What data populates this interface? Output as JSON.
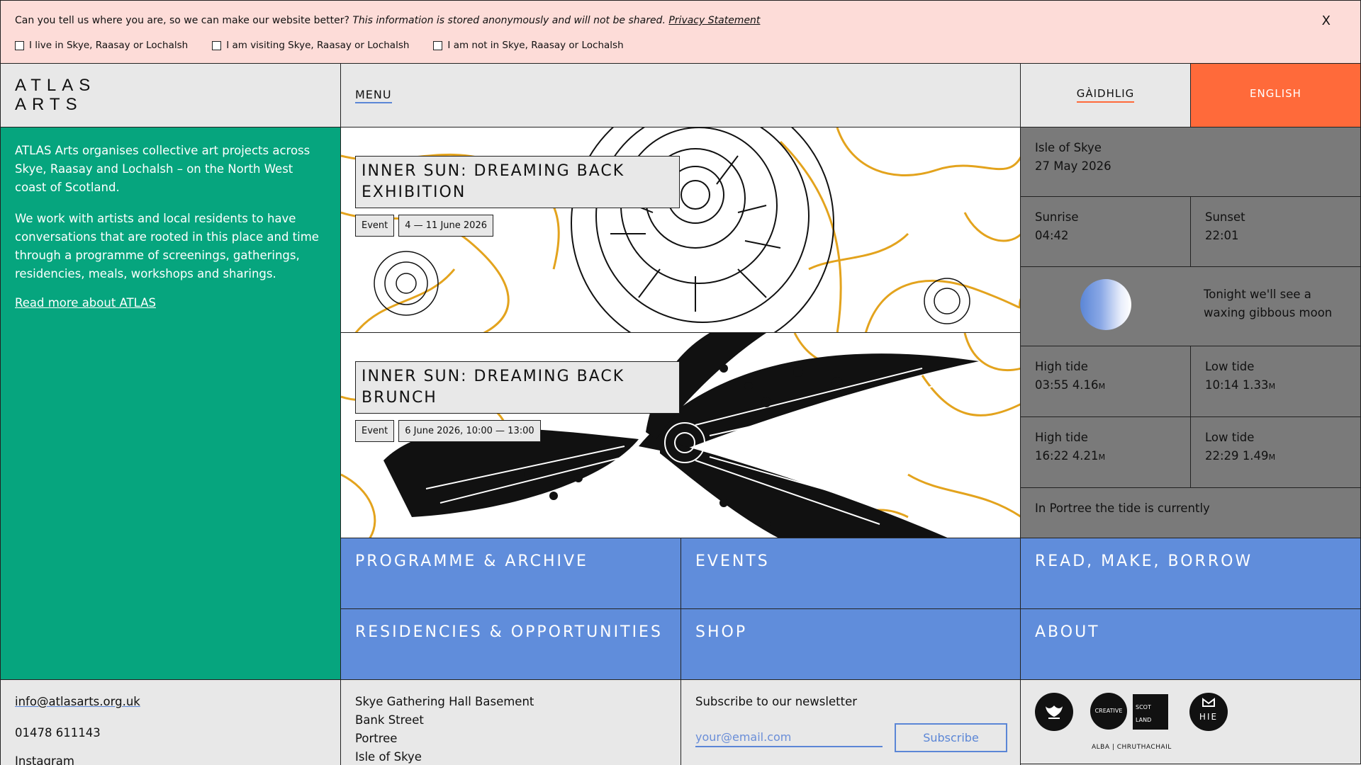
{
  "banner": {
    "question": "Can you tell us where you are, so we can make our website better?",
    "note": "This information is stored anonymously and will not be shared.",
    "privacy_link": "Privacy Statement",
    "close_label": "X",
    "options": [
      "I live in Skye, Raasay or Lochalsh",
      "I am visiting Skye, Raasay or Lochalsh",
      "I am not in Skye, Raasay or Lochalsh"
    ]
  },
  "header": {
    "logo_line1": "ATLAS",
    "logo_line2": "ARTS",
    "menu_label": "MENU",
    "lang_gaelic": "GÀIDHLIG",
    "lang_english": "ENGLISH"
  },
  "about": {
    "para1": "ATLAS Arts organises collective art projects across Skye, Raasay and Lochalsh – on the North West coast of Scotland.",
    "para2": "We work with artists and local residents to have conversations that are rooted in this place and time through a programme of screenings, gatherings, residencies, meals, workshops and sharings.",
    "read_more": "Read more about ATLAS"
  },
  "events": [
    {
      "title": "INNER SUN: DREAMING BACK EXHIBITION",
      "type": "Event",
      "date": "4 — 11 June 2026"
    },
    {
      "title": "INNER SUN: DREAMING BACK BRUNCH",
      "type": "Event",
      "date": "6 June 2026, 10:00  — 13:00"
    }
  ],
  "info": {
    "location": "Isle of Skye",
    "date": "27 May 2026",
    "sunrise_label": "Sunrise",
    "sunrise": "04:42",
    "sunset_label": "Sunset",
    "sunset": "22:01",
    "moon_text": "Tonight we'll see a waxing gibbous moon",
    "moon_illumination": 0.85,
    "high_tide_label": "High tide",
    "low_tide_label": "Low tide",
    "tide1_high_time": "03:55",
    "tide1_high_height": "4.16",
    "tide1_low_time": "10:14",
    "tide1_low_height": "1.33",
    "tide2_high_time": "16:22",
    "tide2_high_height": "4.21",
    "tide2_low_time": "22:29",
    "tide2_low_height": "1.49",
    "unit": "M",
    "tide_now": "In Portree the tide is currently"
  },
  "nav": {
    "programme": "PROGRAMME & ARCHIVE",
    "events": "EVENTS",
    "read": "READ, MAKE, BORROW",
    "residencies": "RESIDENCIES & OPPORTUNITIES",
    "shop": "SHOP",
    "about": "ABOUT"
  },
  "footer": {
    "email": "info@atlasarts.org.uk",
    "phone": "01478 611143",
    "instagram": "Instagram",
    "address": [
      "Skye Gathering Hall Basement",
      "Bank Street",
      "Portree",
      "Isle of Skye"
    ],
    "newsletter_heading": "Subscribe to our newsletter",
    "email_placeholder": "your@email.com",
    "subscribe": "Subscribe",
    "creative_logo_text": "CREATIVE",
    "scot_logo_text": "SCOT LAND",
    "alba_text": "ALBA | CHRUTHACHAIL",
    "hie_text": "HIE"
  },
  "colors": {
    "green": "#06a57e",
    "blue": "#608ddb",
    "orange": "#ff6a3a",
    "grey_panel": "#7a7a7a",
    "banner_pink": "#fddcd8"
  }
}
